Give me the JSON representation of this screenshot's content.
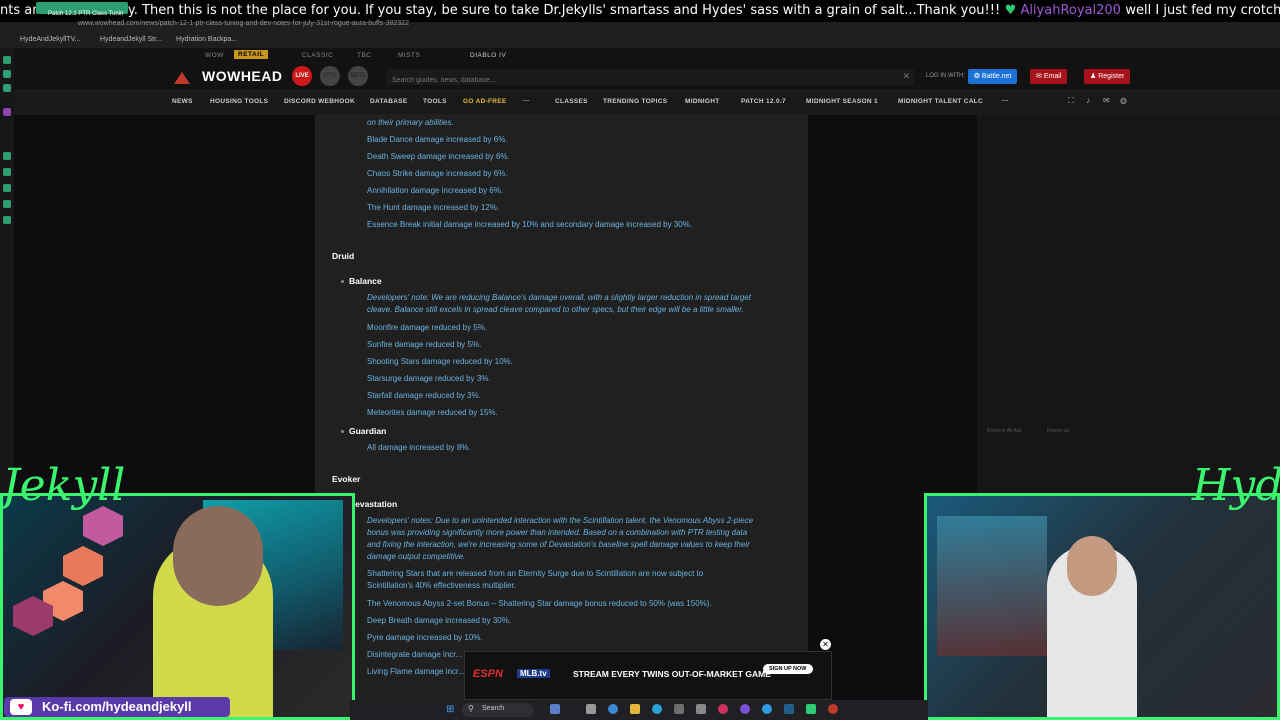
{
  "ticker": {
    "text": "nts and commentary. Then this is not the place for you. If you stay, be sure to take Dr.Jekylls' smartass and Hydes' sass with a grain of salt...Thank you!!!",
    "username": "AliyahRoyal200",
    "message": "well I just fed my crotch goblins their puff cereal"
  },
  "browser": {
    "tab_title": "Patch 12.1 PTR Class Tunin",
    "url": "www.wowhead.com/news/patch-12-1-ptr-class-tuning-and-dev-notes-for-july-31st-rogue-aura-buffs-382322",
    "bookmarks": [
      "HydeAndJekyllTV...",
      "HydeandJekyll Str...",
      "Hydration Backpa..."
    ]
  },
  "site": {
    "version_tabs": [
      "WOW",
      "RETAIL",
      "CLASSIC",
      "TBC",
      "MISTS",
      "DIABLO IV"
    ],
    "logo": "WOWHEAD",
    "live": "LIVE",
    "search_placeholder": "Search guides, news, database...",
    "login_label": "LOG IN WITH:",
    "battlenet": "Battle.net",
    "email": "Email",
    "register": "Register",
    "nav": [
      "NEWS",
      "HOUSING TOOLS",
      "DISCORD WEBHOOK",
      "DATABASE",
      "TOOLS",
      "GO AD-FREE",
      "...",
      "CLASSES",
      "TRENDING TOPICS",
      "MIDNIGHT",
      "PATCH 12.0.7",
      "MIDNIGHT SEASON 1",
      "MIDNIGHT TALENT CALC",
      "..."
    ]
  },
  "article": {
    "dh_note_tail": "on their primary abilities.",
    "dh_items": [
      "Blade Dance damage increased by 6%.",
      "Death Sweep damage increased by 6%.",
      "Chaos Strike damage increased by 6%.",
      "Annihilation damage increased by 6%.",
      "The Hunt damage increased by 12%.",
      "Essence Break initial damage increased by 10% and secondary damage increased by 30%."
    ],
    "druid": "Druid",
    "balance": "Balance",
    "balance_note_1": "Developers' note: We are reducing Balance's damage overall, with a slightly larger reduction in spread target",
    "balance_note_2": "cleave. Balance still excels in spread cleave compared to other specs, but their edge will be a little smaller.",
    "balance_items": [
      "Moonfire damage reduced by 5%.",
      "Sunfire damage reduced by 5%.",
      "Shooting Stars damage reduced by 10%.",
      "Starsurge damage reduced by 3%.",
      "Starfall damage reduced by 3%.",
      "Meteorites damage reduced by 15%."
    ],
    "guardian": "Guardian",
    "guardian_items": [
      "All damage increased by 8%."
    ],
    "evoker": "Evoker",
    "devastation": "Devastation",
    "dev_note_1": "Developers' notes: Due to an unintended interaction with the Scintillation talent, the Venomous Abyss 2-piece",
    "dev_note_2": "bonus was providing significantly more power than intended. Based on a combination with PTR testing data",
    "dev_note_3": "and fixing the interaction, we're increasing some of Devastation's baseline spell damage values to keep their",
    "dev_note_4": "damage output competitive.",
    "dev_item_1a": "Shattering Stars that are released from an Eternity Surge due to Scintillation are now subject to",
    "dev_item_1b": "Scintillation's 40% effectiveness multiplier.",
    "dev_items": [
      "The Venomous Abyss 2-set Bonus – Shattering Star damage bonus reduced to 50% (was 150%).",
      "Deep Breath damage increased by 30%.",
      "Pyre damage increased by 10%.",
      "Disintegrate damage incr...",
      "Living Flame damage incr..."
    ]
  },
  "sidebar_right": {
    "remove_ads": "Remove All Ads",
    "report_ad": "Report ad"
  },
  "overlay": {
    "jekyll": "Jekyll",
    "hyde": "Hyde",
    "kofi": "Ko-fi.com/hydeandjekyll"
  },
  "ad": {
    "brand1": "ESPN",
    "brand2": "MLB.tv",
    "headline": "STREAM EVERY TWINS OUT-OF-MARKET GAME",
    "cta": "SIGN UP NOW"
  },
  "taskbar": {
    "search": "Search"
  }
}
